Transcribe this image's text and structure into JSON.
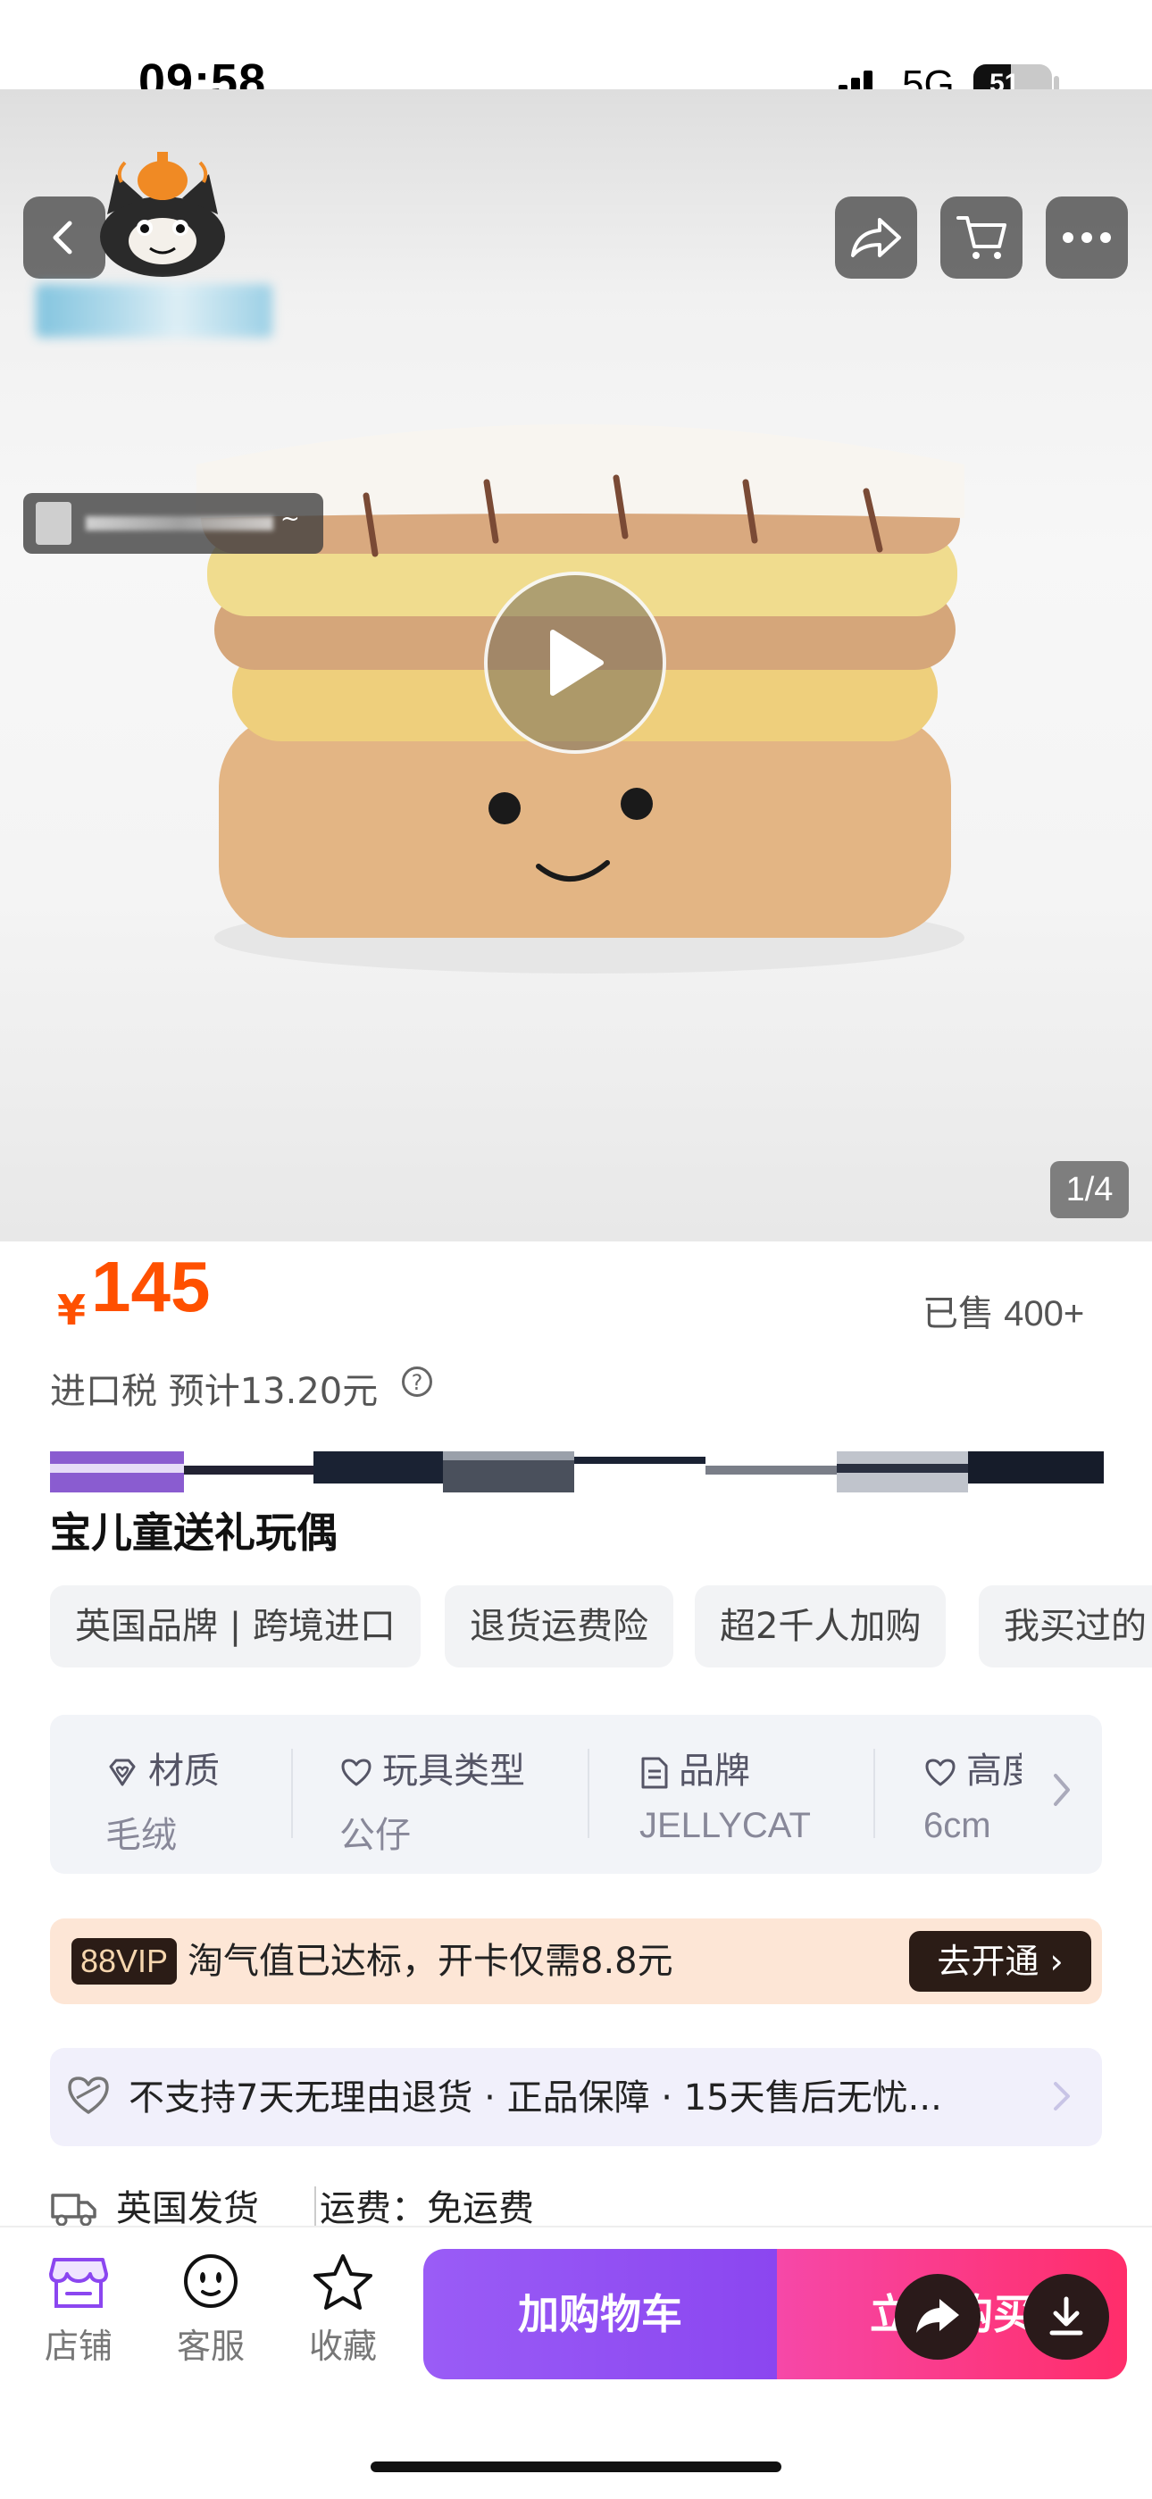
{
  "status": {
    "time": "09:58",
    "network": "5G",
    "battery": "51"
  },
  "hero": {
    "page_indicator": "1/4",
    "live_suffix": "~"
  },
  "product": {
    "currency": "¥",
    "price": "145",
    "sold": "已售 400+",
    "tax": "进口税 预计13.20元",
    "tax_help": "?",
    "title": "宝儿童送礼玩偶"
  },
  "tags": [
    "英国品牌 | 跨境进口",
    "退货运费险",
    "超2千人加购",
    "我买过的"
  ],
  "attributes": [
    {
      "name": "材质",
      "value": "毛绒",
      "icon": "diamond-heart-icon"
    },
    {
      "name": "玩具类型",
      "value": "公仔",
      "icon": "heart-icon"
    },
    {
      "name": "品牌",
      "value": "JELLYCAT",
      "icon": "document-icon"
    },
    {
      "name": "高度",
      "value": "6cm",
      "icon": "heart-icon"
    }
  ],
  "vip": {
    "badge": "88VIP",
    "text": "淘气值已达标，开卡仅需8.8元",
    "button": "去开通 ›"
  },
  "service": {
    "text": "不支持7天无理由退货 · 正品保障 · 15天售后无忧..."
  },
  "shipping": {
    "from": "英国发货",
    "fee": "运费：免运费"
  },
  "bottom": {
    "shop": "店铺",
    "customer_service": "客服",
    "favorite": "收藏",
    "add_to_cart": "加购物车",
    "buy_now": "立即购买"
  },
  "colors": {
    "price": "#ff5000",
    "cart_purple": "#8b46f0",
    "buy_pink": "#ff2d6a",
    "vip_dark": "#2b1c16"
  }
}
